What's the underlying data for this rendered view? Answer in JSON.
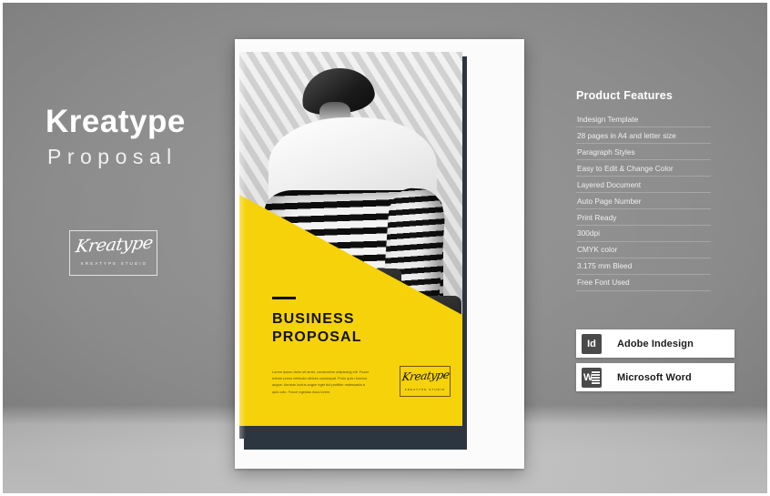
{
  "headline": {
    "title": "Kreatype",
    "subtitle": "Proposal"
  },
  "brand_logo": {
    "script": "Kreatype",
    "studio": "KREATYPE STUDIO"
  },
  "cover": {
    "rule": "",
    "title": "BUSINESS\nPROPOSAL",
    "body": "Lorem ipsum dolor sit amet, consectetur adipiscing elit. Fusce rutrum purus vehicula ultrices consequat. Proin quis rhoncus augue. Aenean luctus augue eget dui porttitor malesuada a quis odio. Fusce egestas risus lorem.",
    "logo_script": "Kreatype",
    "logo_studio": "KREATYPE STUDIO"
  },
  "features": {
    "title": "Product Features",
    "items": [
      "Indesign Template",
      "28 pages in A4 and letter size",
      "Paragraph Styles",
      "Easy to Edit & Change Color",
      "Layered Document",
      "Auto Page Number",
      "Print Ready",
      "300dpi",
      "CMYK color",
      "3.175 mm Bleed",
      "Free Font Used"
    ]
  },
  "badges": [
    {
      "icon": "indesign-icon",
      "glyph": "Id",
      "label": "Adobe Indesign"
    },
    {
      "icon": "word-icon",
      "glyph": "W",
      "label": "Microsoft Word"
    }
  ],
  "colors": {
    "background": "#8a8a8a",
    "background_bottom": "#cfcfcf",
    "accent_yellow": "#f5d20a",
    "navy": "#2b3641",
    "page_white": "#fbfbfb",
    "icon_gray": "#4a4a4a"
  }
}
